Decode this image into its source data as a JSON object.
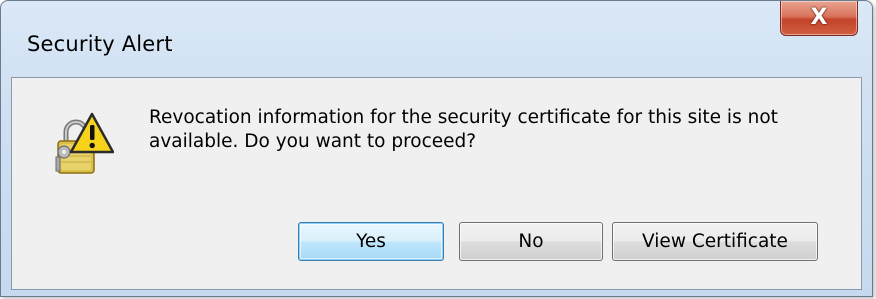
{
  "window": {
    "title": "Security Alert",
    "close_label": "X"
  },
  "dialog": {
    "icon": "lock-warning-icon",
    "message": "Revocation information for the security certificate for this site is not available. Do you want to proceed?"
  },
  "buttons": {
    "yes": "Yes",
    "no": "No",
    "view_certificate": "View Certificate"
  },
  "colors": {
    "frame": "#cfe0f2",
    "client": "#f0f0f0",
    "close_button": "#c4432b",
    "default_button": "#bee6fd"
  }
}
